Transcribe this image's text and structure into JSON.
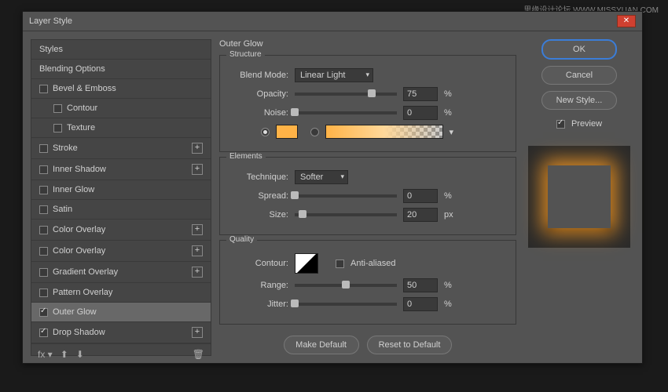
{
  "watermark": "思缘设计论坛 WWW.MISSYUAN.COM",
  "dialog": {
    "title": "Layer Style"
  },
  "sidebar": {
    "styles": "Styles",
    "blending": "Blending Options",
    "items": [
      {
        "label": "Bevel & Emboss",
        "checked": false,
        "plus": false
      },
      {
        "label": "Contour",
        "checked": false,
        "sub": true
      },
      {
        "label": "Texture",
        "checked": false,
        "sub": true
      },
      {
        "label": "Stroke",
        "checked": false,
        "plus": true
      },
      {
        "label": "Inner Shadow",
        "checked": false,
        "plus": true
      },
      {
        "label": "Inner Glow",
        "checked": false
      },
      {
        "label": "Satin",
        "checked": false
      },
      {
        "label": "Color Overlay",
        "checked": false,
        "plus": true
      },
      {
        "label": "Color Overlay",
        "checked": false,
        "plus": true
      },
      {
        "label": "Gradient Overlay",
        "checked": false,
        "plus": true
      },
      {
        "label": "Pattern Overlay",
        "checked": false
      },
      {
        "label": "Outer Glow",
        "checked": true,
        "selected": true
      },
      {
        "label": "Drop Shadow",
        "checked": true,
        "plus": true
      }
    ]
  },
  "main": {
    "title": "Outer Glow",
    "structure": {
      "title": "Structure",
      "blend_label": "Blend Mode:",
      "blend_value": "Linear Light",
      "opacity_label": "Opacity:",
      "opacity_value": "75",
      "opacity_pct": 75,
      "noise_label": "Noise:",
      "noise_value": "0",
      "noise_pct": 0,
      "percent": "%",
      "solid_color": "#ffb347"
    },
    "elements": {
      "title": "Elements",
      "technique_label": "Technique:",
      "technique_value": "Softer",
      "spread_label": "Spread:",
      "spread_value": "0",
      "spread_pct": 0,
      "size_label": "Size:",
      "size_value": "20",
      "size_pct": 8,
      "size_unit": "px",
      "percent": "%"
    },
    "quality": {
      "title": "Quality",
      "contour_label": "Contour:",
      "aa_label": "Anti-aliased",
      "range_label": "Range:",
      "range_value": "50",
      "range_pct": 50,
      "jitter_label": "Jitter:",
      "jitter_value": "0",
      "jitter_pct": 0,
      "percent": "%"
    },
    "make_default": "Make Default",
    "reset_default": "Reset to Default"
  },
  "buttons": {
    "ok": "OK",
    "cancel": "Cancel",
    "new_style": "New Style...",
    "preview": "Preview"
  }
}
